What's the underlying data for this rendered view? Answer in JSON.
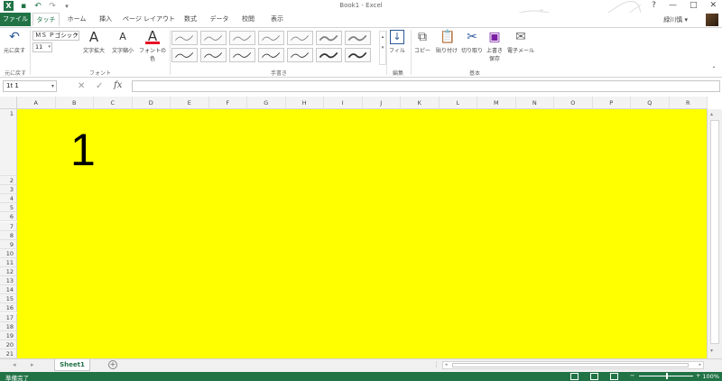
{
  "titlebar": {
    "app_logo": "X",
    "title": "Book1 - Excel",
    "icons": [
      "save-icon",
      "undo-icon",
      "redo-icon"
    ],
    "window_buttons": [
      "?",
      "—",
      "□",
      "✕"
    ]
  },
  "tabs": {
    "file": "ファイル",
    "items": [
      "タッチ",
      "ホーム",
      "挿入",
      "ページ レイアウト",
      "数式",
      "データ",
      "校閲",
      "表示"
    ],
    "active_index": 0,
    "user": "緑川慎 ▾"
  },
  "ribbon": {
    "undo_label": "元に戻す",
    "undo_group": "元に戻す",
    "font_name": "ＭＳ Ｐゴシック",
    "font_size": "11",
    "grow_font": "文字拡大",
    "shrink_font": "文字縮小",
    "font_color": "フォントの色",
    "font_group": "フォント",
    "handwriting_group": "手書き",
    "fill_label": "フィル",
    "edit_group": "編集",
    "copy": "コピー",
    "paste": "貼り付け",
    "cut": "切り取り",
    "save_overwrite": "上書き\n保存",
    "email": "電子メール",
    "basic_group": "基本",
    "accent_red": "#e81123"
  },
  "formula_bar": {
    "name_box": "1t 1",
    "cancel": "✕",
    "enter": "✓",
    "fx": "fx",
    "content": ""
  },
  "grid": {
    "columns": [
      "A",
      "B",
      "C",
      "D",
      "E",
      "F",
      "G",
      "H",
      "I",
      "J",
      "K",
      "L",
      "M",
      "N",
      "O",
      "P",
      "Q",
      "R"
    ],
    "rows": [
      "1",
      "2",
      "3",
      "4",
      "5",
      "6",
      "7",
      "8",
      "9",
      "10",
      "11",
      "12",
      "13",
      "14",
      "15",
      "16",
      "17",
      "18",
      "19",
      "20",
      "21"
    ],
    "fill_color": "#ffff00",
    "cell_text": "1"
  },
  "sheets": {
    "nav_prev": "◂",
    "nav_next": "▸",
    "tabs": [
      "Sheet1"
    ],
    "add": "+",
    "ellipsis": "⋮"
  },
  "status": {
    "text": "準備完了",
    "zoom": "100%",
    "zoom_minus": "−",
    "zoom_plus": "+"
  }
}
